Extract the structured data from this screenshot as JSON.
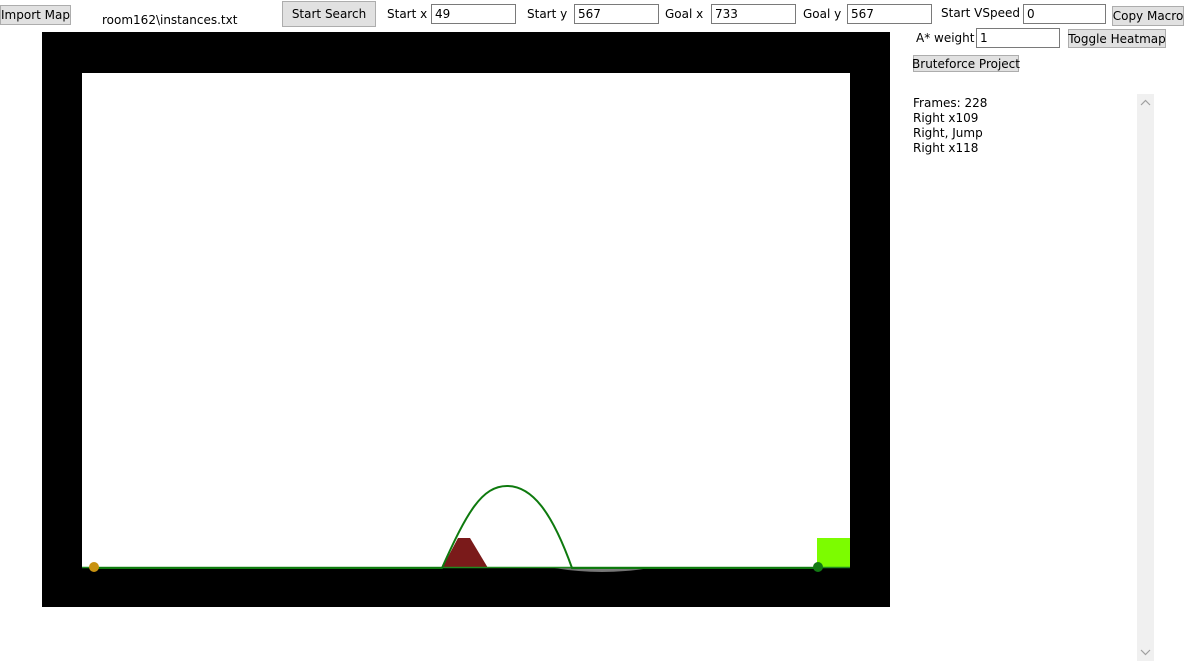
{
  "toolbar": {
    "import_map_label": "Import Map",
    "map_file": "room162\\instances.txt",
    "start_search_label": "Start Search",
    "start_x_label": "Start x",
    "start_x_value": "49",
    "start_y_label": "Start y",
    "start_y_value": "567",
    "goal_x_label": "Goal x",
    "goal_x_value": "733",
    "goal_y_label": "Goal y",
    "goal_y_value": "567",
    "start_vspeed_label": "Start VSpeed",
    "start_vspeed_value": "0",
    "copy_macro_label": "Copy Macro",
    "astar_weight_label": "A* weight",
    "astar_weight_value": "1",
    "toggle_heatmap_label": "Toggle Heatmap",
    "bruteforce_label": "Bruteforce Project"
  },
  "output": {
    "lines": [
      "Frames: 228",
      "Right x109",
      "Right, Jump",
      "Right x118"
    ]
  },
  "colors": {
    "wall": "#000000",
    "floor_line": "#1f8a1f",
    "path": "#0e7a0e",
    "hazard": "#7a1a1a",
    "goal_block": "#7cfc00",
    "start_marker": "#c89211",
    "goal_marker": "#137a13"
  },
  "icons": {
    "scroll_up": "chevron-up-icon",
    "scroll_down": "chevron-down-icon"
  }
}
